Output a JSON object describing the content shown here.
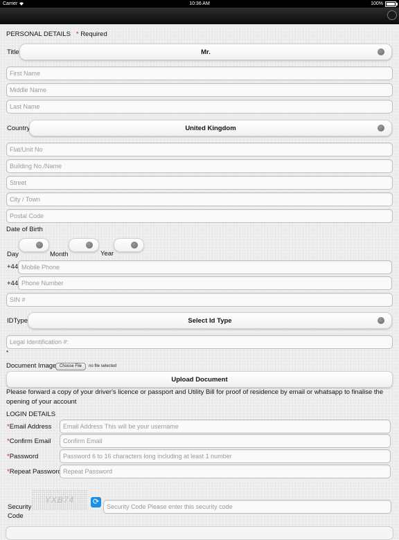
{
  "status_bar": {
    "carrier": "Carrier",
    "time": "10:36 AM",
    "battery": "100%"
  },
  "personal": {
    "heading": "PERSONAL DETAILS",
    "required_star": "*",
    "required_text": "Required",
    "title_label": "Title",
    "title_value": "Mr.",
    "first_name_ph": "First Name",
    "middle_name_ph": "Middle Name",
    "last_name_ph": "Last Name",
    "country_label": "Country",
    "country_value": "United Kingdom",
    "flat_ph": "Flat/Unit No",
    "building_ph": "Building No./Name",
    "street_ph": "Street",
    "city_ph": "City / Town",
    "postal_ph": "Postal Code",
    "dob_label": "Date of Birth",
    "day_label": "Day",
    "month_label": "Month",
    "year_label": "Year",
    "mobile_prefix": "+44",
    "mobile_ph": "Mobile Phone",
    "phone_prefix": "+44",
    "phone_ph": "Phone Number",
    "sin_ph": "SIN #",
    "idtype_label": "IDType",
    "idtype_value": "Select Id Type",
    "legal_id_ph": "Legal Identification #:",
    "legal_star": "*",
    "doc_label": "Document Image",
    "choose_file": "Choose File",
    "no_file": "no file selected",
    "upload_label": "Upload Document",
    "note": "Please forward a copy of your driver's licence or passport and Utility Bill for proof of residence by email or whatsapp to finalise the opening of your account"
  },
  "login": {
    "heading": "LOGIN DETAILS",
    "email_label": "Email Address",
    "email_ph": "Email Address This will be your username",
    "confirm_label": "Confirm Email",
    "confirm_ph": "Confirm Email",
    "password_label": "Password",
    "password_ph": "Password 6 to 16 characters long including at least 1 number",
    "repeat_label": "Repeat Password",
    "repeat_ph": "Repeat Password",
    "star": "*",
    "security_label_1": "Security",
    "security_label_2": "Code",
    "captcha_text": "YXB74",
    "security_ph": "Security Code Please enter this security code",
    "refresh_icon": "⟳"
  }
}
